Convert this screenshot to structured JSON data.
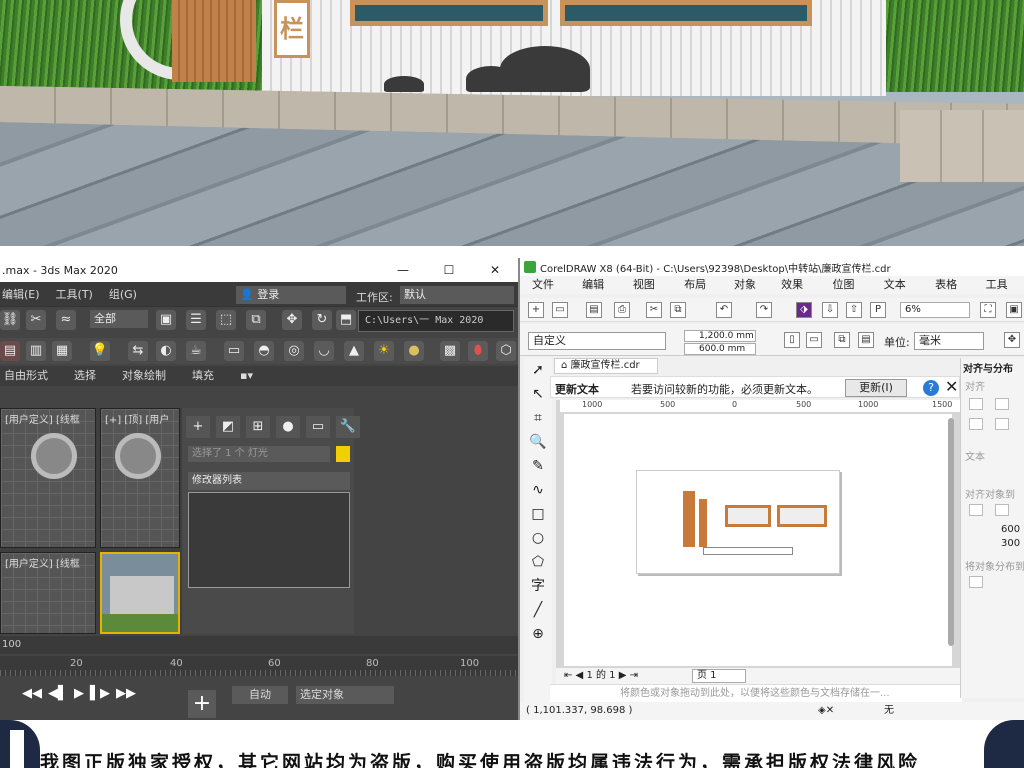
{
  "photo": {
    "sign_char": "栏"
  },
  "max": {
    "window_title": ".max - 3ds Max 2020",
    "win_min": "—",
    "win_max": "☐",
    "win_close": "✕",
    "menu": [
      "编辑(E)",
      "工具(T)",
      "组(G)"
    ],
    "login": "登录",
    "workspace_label": "工作区:",
    "workspace_value": "默认",
    "selection_filter": "全部",
    "path": "C:\\Users\\一 Max 2020",
    "ribbon": [
      "自由形式",
      "选择",
      "对象绘制",
      "填充"
    ],
    "viewport_labels": [
      "[用户定义] [线框",
      "[+] [顶] [用户",
      "[用户定义] [线框"
    ],
    "selection_info": "选择了 1 个 灯光",
    "modifier_list": "修改器列表",
    "time_value": "100",
    "ruler_ticks": [
      "20",
      "40",
      "60",
      "80",
      "100"
    ],
    "auto_key": "自动",
    "selected_object": "选定对象",
    "play_controls": [
      "◀◀",
      "◀▌",
      "▶",
      "▌▶",
      "▶▶"
    ]
  },
  "corel": {
    "window_title": "CorelDRAW X8 (64-Bit) - C:\\Users\\92398\\Desktop\\中转站\\廉政宣传栏.cdr",
    "menu": [
      "文件(F)",
      "编辑(E)",
      "视图(V)",
      "布局(L)",
      "对象(J)",
      "效果(C)",
      "位图(B)",
      "文本(X)",
      "表格(T)",
      "工具(O)"
    ],
    "zoom": "6%",
    "paper": "自定义",
    "width": "1,200.0 mm",
    "height": "600.0 mm",
    "unit_label": "单位:",
    "unit_value": "毫米",
    "doc_tab": "廉政宣传栏.cdr",
    "notice_title": "更新文本",
    "notice_text": "若要访问较新的功能，必须更新文本。",
    "update_button": "更新(I)",
    "help": "?",
    "close": "✕",
    "ruler_ticks": [
      "1000",
      "500",
      "0",
      "500",
      "1000",
      "1500"
    ],
    "page_nav": "1 的 1",
    "page_tab": "页 1",
    "color_hint": "将颜色或对象拖动到此处，以便将这些颜色与文档存储在一...",
    "status_coords": "( 1,101.337, 98.698 )",
    "status_fill": "无",
    "docker_title": "对齐与分布",
    "docker_align": "对齐",
    "docker_text": "文本",
    "docker_align_to": "对齐对象到",
    "docker_distribute": "将对象分布到",
    "docker_val1": "600",
    "docker_val2": "300"
  },
  "banner": {
    "text": "我图正版独家授权，其它网站均为盗版，购买使用盗版均属违法行为，需承担版权法律风险"
  }
}
